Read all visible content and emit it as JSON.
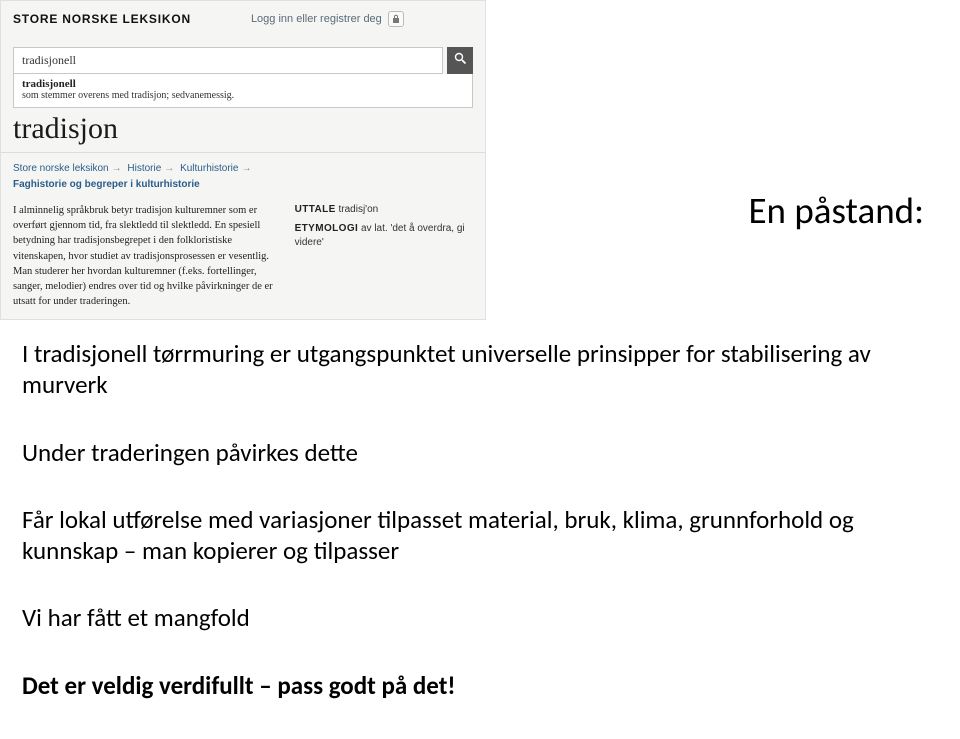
{
  "lexicon": {
    "site_name": "STORE NORSKE LEKSIKON",
    "login_text": "Logg inn eller registrer deg",
    "search_value": "tradisjonell",
    "suggest": {
      "term": "tradisjonell",
      "desc": "som stemmer overens med tradisjon; sedvanemessig."
    },
    "article_title": "tradisjon",
    "breadcrumbs": {
      "b1": "Store norske leksikon",
      "b2": "Historie",
      "b3": "Kulturhistorie",
      "b4": "Faghistorie og begreper i kulturhistorie"
    },
    "body_text": "I alminnelig språkbruk betyr tradisjon kulturemner som er overført gjennom tid, fra slektledd til slektledd. En spesiell betydning har tradisjonsbegrepet i den folkloristiske vitenskapen, hvor studiet av tradisjonsprosessen er vesentlig. Man studerer her hvordan kulturemner (f.eks. fortellinger, sanger, melodier) endres over tid og hvilke påvirkninger de er utsatt for under traderingen.",
    "sidebar": {
      "uttale_label": "UTTALE",
      "uttale_value": "tradisj'on",
      "etym_label": "ETYMOLOGI",
      "etym_value": "av lat. 'det å overdra, gi videre'"
    }
  },
  "slide": {
    "heading": "En påstand:",
    "p1": "I tradisjonell tørrmuring er utgangspunktet universelle prinsipper for stabilisering av murverk",
    "p2": "Under traderingen påvirkes dette",
    "p3": "Får lokal utførelse med variasjoner tilpasset material, bruk, klima, grunnforhold og  kunnskap – man kopierer og tilpasser",
    "p4": "Vi har fått et mangfold",
    "p5": "Det er veldig verdifullt – pass godt på det!"
  }
}
